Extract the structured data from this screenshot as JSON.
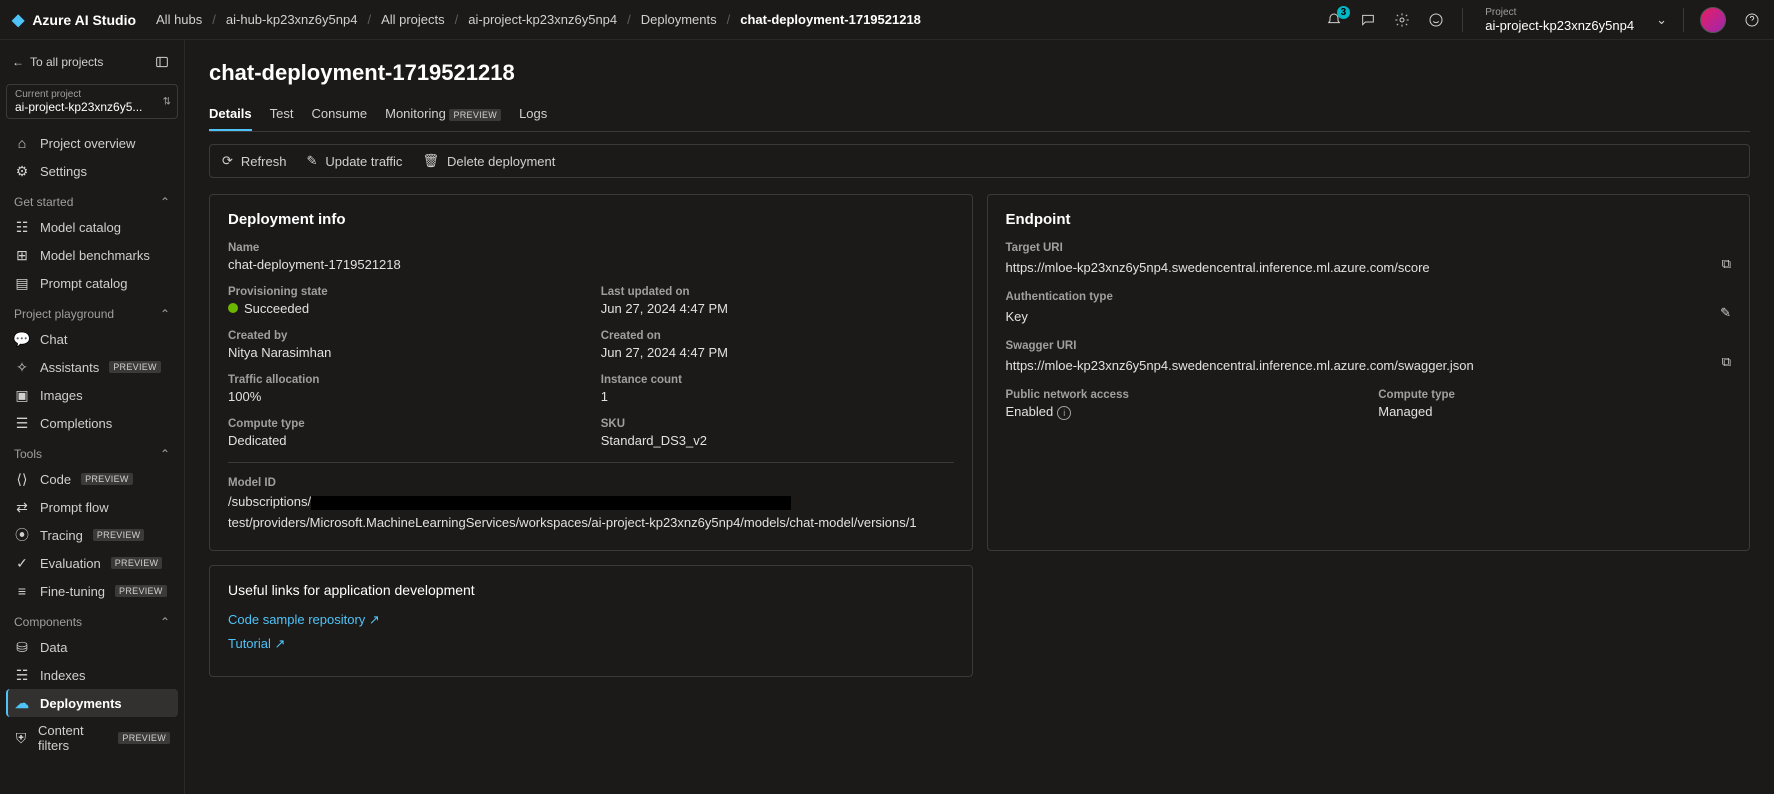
{
  "header": {
    "brand": "Azure AI Studio",
    "breadcrumbs": [
      "All hubs",
      "ai-hub-kp23xnz6y5np4",
      "All projects",
      "ai-project-kp23xnz6y5np4",
      "Deployments",
      "chat-deployment-1719521218"
    ],
    "notification_count": "3",
    "project_label": "Project",
    "project_value": "ai-project-kp23xnz6y5np4"
  },
  "sidebar": {
    "back_label": "To all projects",
    "current_project_label": "Current project",
    "current_project_value": "ai-project-kp23xnz6y5...",
    "top_items": [
      {
        "label": "Project overview"
      },
      {
        "label": "Settings"
      }
    ],
    "sections": [
      {
        "title": "Get started",
        "items": [
          {
            "label": "Model catalog"
          },
          {
            "label": "Model benchmarks"
          },
          {
            "label": "Prompt catalog"
          }
        ]
      },
      {
        "title": "Project playground",
        "items": [
          {
            "label": "Chat"
          },
          {
            "label": "Assistants",
            "preview": "PREVIEW"
          },
          {
            "label": "Images"
          },
          {
            "label": "Completions"
          }
        ]
      },
      {
        "title": "Tools",
        "items": [
          {
            "label": "Code",
            "preview": "PREVIEW"
          },
          {
            "label": "Prompt flow"
          },
          {
            "label": "Tracing",
            "preview": "PREVIEW"
          },
          {
            "label": "Evaluation",
            "preview": "PREVIEW"
          },
          {
            "label": "Fine-tuning",
            "preview": "PREVIEW"
          }
        ]
      },
      {
        "title": "Components",
        "items": [
          {
            "label": "Data"
          },
          {
            "label": "Indexes"
          },
          {
            "label": "Deployments",
            "active": true
          },
          {
            "label": "Content filters",
            "preview": "PREVIEW"
          }
        ]
      }
    ]
  },
  "main": {
    "title": "chat-deployment-1719521218",
    "tabs": [
      "Details",
      "Test",
      "Consume",
      "Monitoring",
      "Logs"
    ],
    "tab_preview_index": 3,
    "tab_preview_label": "PREVIEW",
    "toolbar": {
      "refresh": "Refresh",
      "update": "Update traffic",
      "delete": "Delete deployment"
    },
    "deployment_info": {
      "title": "Deployment info",
      "name_label": "Name",
      "name_value": "chat-deployment-1719521218",
      "prov_label": "Provisioning state",
      "prov_value": "Succeeded",
      "updated_label": "Last updated on",
      "updated_value": "Jun 27, 2024 4:47 PM",
      "createdby_label": "Created by",
      "createdby_value": "Nitya Narasimhan",
      "createdon_label": "Created on",
      "createdon_value": "Jun 27, 2024 4:47 PM",
      "traffic_label": "Traffic allocation",
      "traffic_value": "100%",
      "instance_label": "Instance count",
      "instance_value": "1",
      "compute_label": "Compute type",
      "compute_value": "Dedicated",
      "sku_label": "SKU",
      "sku_value": "Standard_DS3_v2",
      "model_label": "Model ID",
      "model_prefix": "/subscriptions/",
      "model_suffix": "test/providers/Microsoft.MachineLearningServices/workspaces/ai-project-kp23xnz6y5np4/models/chat-model/versions/1"
    },
    "endpoint": {
      "title": "Endpoint",
      "target_label": "Target URI",
      "target_value": "https://mloe-kp23xnz6y5np4.swedencentral.inference.ml.azure.com/score",
      "auth_label": "Authentication type",
      "auth_value": "Key",
      "swagger_label": "Swagger URI",
      "swagger_value": "https://mloe-kp23xnz6y5np4.swedencentral.inference.ml.azure.com/swagger.json",
      "pna_label": "Public network access",
      "pna_value": "Enabled",
      "ctype_label": "Compute type",
      "ctype_value": "Managed"
    },
    "useful": {
      "title": "Useful links for application development",
      "link1": "Code sample repository",
      "link2": "Tutorial"
    }
  }
}
